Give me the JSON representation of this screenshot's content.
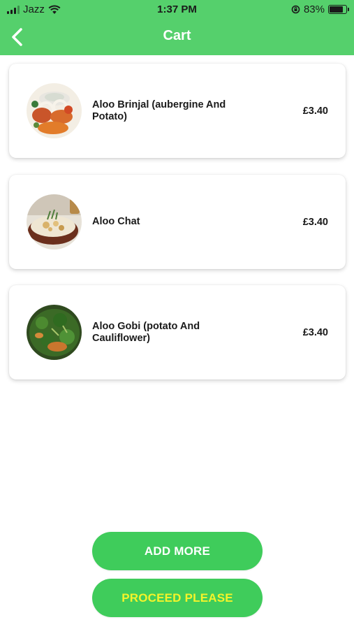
{
  "status_bar": {
    "carrier": "Jazz",
    "time": "1:37 PM",
    "battery": "83%",
    "battery_level": 0.83
  },
  "header": {
    "title": "Cart",
    "back_icon": "chevron-left-icon",
    "background": "#55d06c"
  },
  "cart": {
    "items": [
      {
        "name": "Aloo Brinjal (aubergine And Potato)",
        "price": "£3.40"
      },
      {
        "name": "Aloo Chat",
        "price": "£3.40"
      },
      {
        "name": "Aloo Gobi (potato And Cauliflower)",
        "price": "£3.40"
      }
    ]
  },
  "actions": {
    "add_more": "ADD MORE",
    "proceed": "PROCEED PLEASE"
  },
  "colors": {
    "accent": "#3fcc5b",
    "proceed_text": "#f4f42a"
  }
}
